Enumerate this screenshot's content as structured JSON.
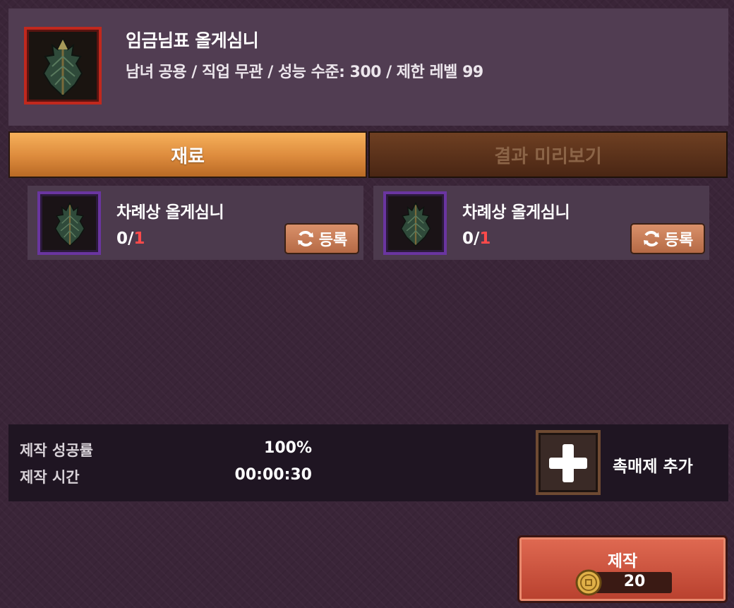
{
  "item": {
    "icon": "leaf-armor-icon",
    "name": "임금님표 올게심니",
    "description": "남녀 공용 / 직업 무관 / 성능 수준: 300 / 제한 레벨 99"
  },
  "tabs": [
    {
      "label": "재료",
      "active": true
    },
    {
      "label": "결과 미리보기",
      "active": false
    }
  ],
  "materials": [
    {
      "icon": "leaf-armor-icon",
      "name": "차례상 올게심니",
      "have": "0",
      "separator": "/",
      "need": "1",
      "register_label": "등록"
    },
    {
      "icon": "leaf-armor-icon",
      "name": "차례상 올게심니",
      "have": "0",
      "separator": "/",
      "need": "1",
      "register_label": "등록"
    }
  ],
  "stats": {
    "success_rate_label": "제작 성공률",
    "success_rate_value": "100%",
    "time_label": "제작 시간",
    "time_value": "00:00:30"
  },
  "catalyst": {
    "label": "촉매제 추가",
    "icon": "plus-icon"
  },
  "craft": {
    "label": "제작",
    "cost": "20",
    "currency_icon": "gold-coin-icon"
  },
  "colors": {
    "accent_tab": "#dc8a3c",
    "craft_button": "#c84a36",
    "need_count": "#ff4a4a",
    "item_frame": "#c1281d",
    "material_frame": "#6a35a0"
  }
}
